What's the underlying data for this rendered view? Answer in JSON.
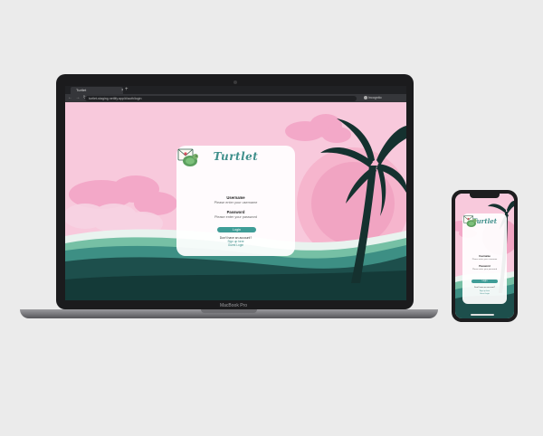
{
  "browser": {
    "tab_title": "Turtlet",
    "tab_close": "×",
    "new_tab": "+",
    "nav_icons": "← → ↻",
    "url": "turtlet-staging.netlify.app/#/auth/login",
    "profile": "Incognito"
  },
  "login": {
    "logo": "Turtlet",
    "username_label": "Username",
    "username_placeholder": "Please enter your username",
    "password_label": "Password",
    "password_placeholder": "Please enter your password",
    "login_button": "Login",
    "signup_prompt": "Don't have an account?",
    "signup_link": "Sign up here",
    "guest_link": "Guest Login"
  },
  "laptop": {
    "model": "MacBook Pro"
  },
  "colors": {
    "brand": "#3f8f8b",
    "button": "#3f9d97",
    "sky": "#f8c9dc",
    "sun": "#f1a4c2",
    "sea": "#1d4f4c"
  }
}
